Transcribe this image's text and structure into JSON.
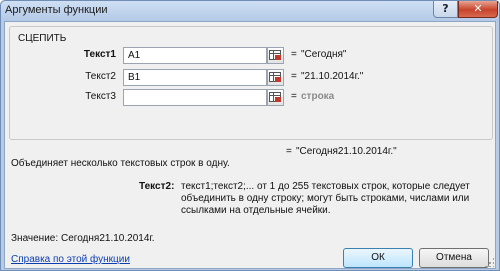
{
  "window": {
    "title": "Аргументы функции",
    "help_button": "?",
    "close_button": "✕"
  },
  "function": {
    "name": "СЦЕПИТЬ",
    "args": [
      {
        "label": "Текст1",
        "bold": true,
        "value": "A1",
        "result": "\"Сегодня\""
      },
      {
        "label": "Текст2",
        "bold": false,
        "value": "B1",
        "result": "\"21.10.2014г.\""
      },
      {
        "label": "Текст3",
        "bold": false,
        "value": "",
        "result": "строка"
      }
    ],
    "result": "\"Сегодня21.10.2014г.\"",
    "description": "Объединяет несколько текстовых строк в одну.",
    "arg_help_name": "Текст2:",
    "arg_help_text": "текст1;текст2;... от 1 до 255 текстовых строк, которые следует объединить в одну строку; могут быть строками, числами или ссылками на отдельные ячейки.",
    "value_label": "Значение:",
    "value": "Сегодня21.10.2014г.",
    "equals": "="
  },
  "footer": {
    "help_link": "Справка по этой функции",
    "ok_label": "ОК",
    "cancel_label": "Отмена"
  }
}
